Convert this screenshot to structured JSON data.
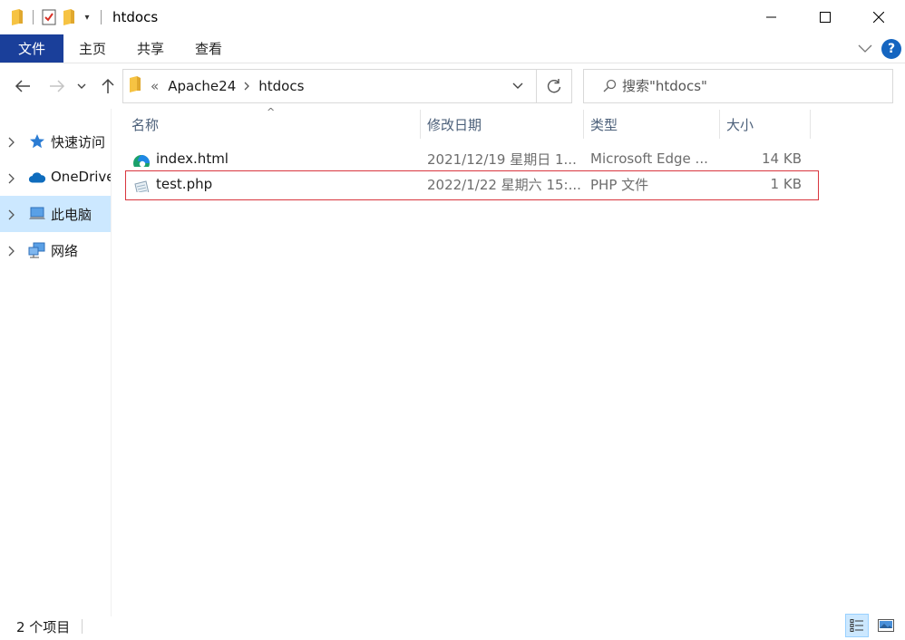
{
  "window": {
    "title": "htdocs",
    "controls": [
      "minimize",
      "maximize",
      "close"
    ]
  },
  "ribbon": {
    "tabs": [
      "文件",
      "主页",
      "共享",
      "查看"
    ]
  },
  "navigation": {
    "breadcrumb_overflow": "«",
    "breadcrumb": [
      "Apache24",
      "htdocs"
    ],
    "search_placeholder": "搜索\"htdocs\""
  },
  "sidebar": {
    "items": [
      {
        "label": "快速访问",
        "icon": "star-icon",
        "selected": false
      },
      {
        "label": "OneDrive",
        "icon": "cloud-icon",
        "selected": false
      },
      {
        "label": "此电脑",
        "icon": "computer-icon",
        "selected": true
      },
      {
        "label": "网络",
        "icon": "network-icon",
        "selected": false
      }
    ]
  },
  "file_list": {
    "columns": [
      "名称",
      "修改日期",
      "类型",
      "大小"
    ],
    "sort_indicator": "^",
    "rows": [
      {
        "name": "index.html",
        "modified": "2021/12/19 星期日 1...",
        "type": "Microsoft Edge ...",
        "size": "14 KB",
        "icon": "edge-icon"
      },
      {
        "name": "test.php",
        "modified": "2022/1/22 星期六 15:...",
        "type": "PHP 文件",
        "size": "1 KB",
        "icon": "php-file-icon",
        "highlighted": true
      }
    ]
  },
  "status_bar": {
    "item_count": "2 个项目"
  },
  "colors": {
    "file_tab": "#1a3f9a",
    "selection": "#cce8ff",
    "highlight_border": "#d9363e",
    "folder": "#f6c343",
    "help": "#1565c0"
  }
}
